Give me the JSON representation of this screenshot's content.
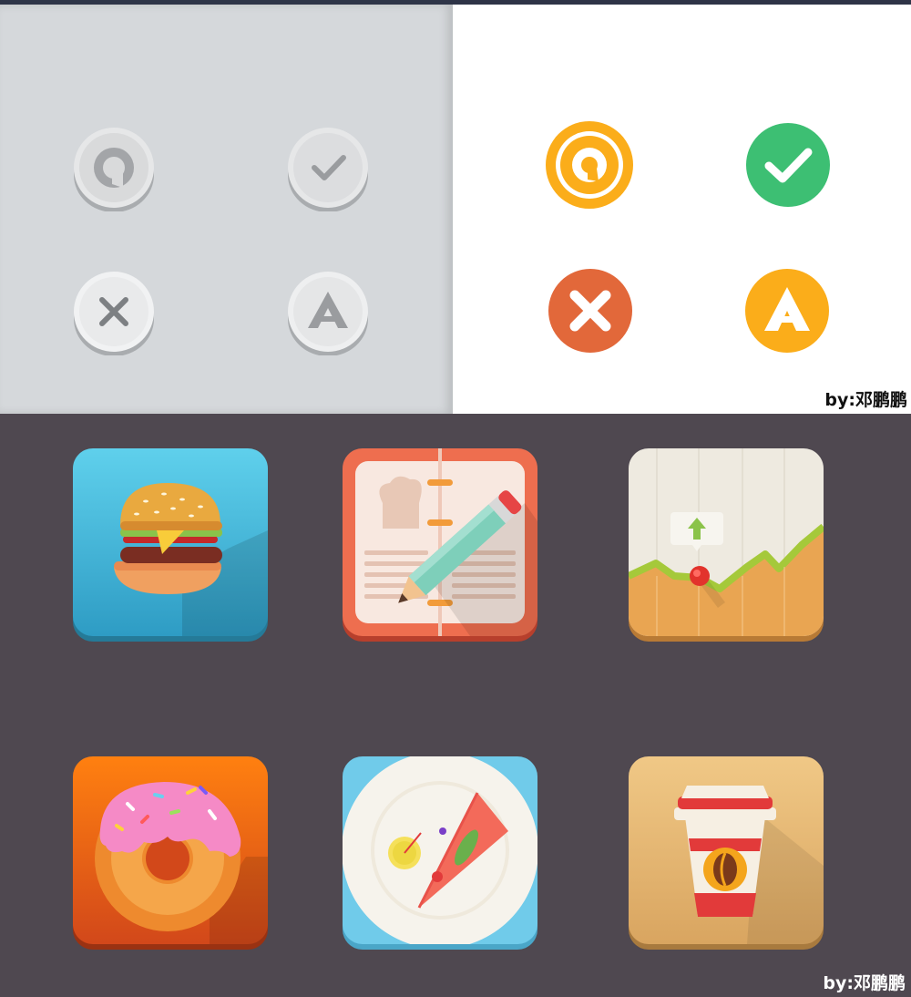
{
  "credits": {
    "top": "by:邓鹏鹏",
    "bottom": "by:邓鹏鹏"
  },
  "colors": {
    "orange": "#fbad1a",
    "green": "#3dbf73",
    "red_orange": "#e2683a",
    "gray_panel": "#d5d8db",
    "dark_panel": "#4f4850"
  },
  "gray_buttons": [
    {
      "icon": "q-logo-icon",
      "glyph": "Q"
    },
    {
      "icon": "checkmark-icon"
    },
    {
      "icon": "close-icon"
    },
    {
      "icon": "a-logo-icon",
      "glyph": "A"
    }
  ],
  "color_buttons": [
    {
      "icon": "q-logo-icon",
      "glyph": "Q",
      "color": "#fbad1a"
    },
    {
      "icon": "checkmark-icon",
      "color": "#3dbf73"
    },
    {
      "icon": "close-icon",
      "color": "#e2683a"
    },
    {
      "icon": "a-logo-icon",
      "glyph": "A",
      "color": "#fbad1a"
    }
  ],
  "app_icons": [
    {
      "icon": "burger-icon"
    },
    {
      "icon": "recipe-notebook-icon"
    },
    {
      "icon": "stock-chart-icon"
    },
    {
      "icon": "donut-icon"
    },
    {
      "icon": "pizza-plate-icon"
    },
    {
      "icon": "coffee-cup-icon"
    }
  ]
}
